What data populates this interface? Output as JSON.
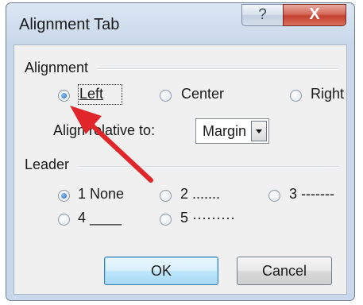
{
  "dialog": {
    "title": "Alignment Tab",
    "help_glyph": "?",
    "close_glyph": "X"
  },
  "alignment": {
    "heading": "Alignment",
    "options": [
      {
        "label": "Left",
        "checked": true
      },
      {
        "label": "Center",
        "checked": false
      },
      {
        "label": "Right",
        "checked": false
      }
    ],
    "relative_label": "Align relative to:",
    "relative_value": "Margin"
  },
  "leader": {
    "heading": "Leader",
    "options": [
      {
        "label": "1 None",
        "checked": true
      },
      {
        "label": "2 .......",
        "checked": false
      },
      {
        "label": "3 -------",
        "checked": false
      },
      {
        "label": "4 ____",
        "checked": false
      },
      {
        "label": "5 ·········",
        "checked": false
      }
    ]
  },
  "buttons": {
    "ok": "OK",
    "cancel": "Cancel"
  },
  "annotation": {
    "arrow_color": "#e0262a"
  }
}
